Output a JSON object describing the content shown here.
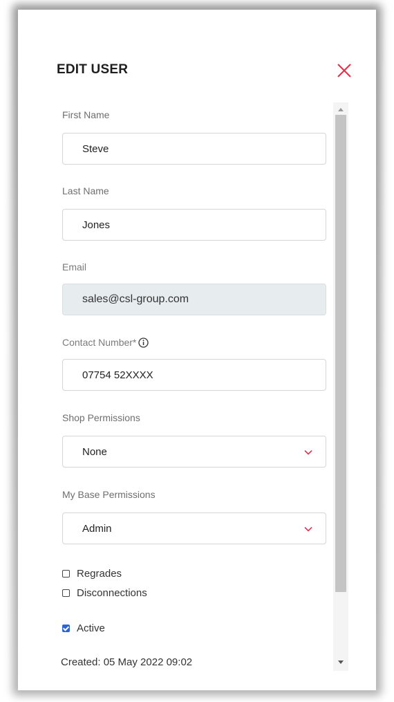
{
  "dialog": {
    "title": "EDIT USER"
  },
  "icons": {
    "close": "close-icon",
    "info": "info-icon",
    "chevron": "chevron-down-icon"
  },
  "colors": {
    "accent": "#e0344f",
    "checkbox_checked": "#2c63d8",
    "disabled_field": "#e7ecee"
  },
  "form": {
    "first_name": {
      "label": "First Name",
      "value": "Steve"
    },
    "last_name": {
      "label": "Last Name",
      "value": "Jones"
    },
    "email": {
      "label": "Email",
      "value": "sales@csl-group.com"
    },
    "contact": {
      "label": "Contact Number*",
      "value": "07754 52XXXX"
    },
    "shop_permissions": {
      "label": "Shop Permissions",
      "value": "None"
    },
    "mybase_permissions": {
      "label": "My Base Permissions",
      "value": "Admin"
    },
    "checkboxes": [
      {
        "label": "Regrades",
        "checked": false
      },
      {
        "label": "Disconnections",
        "checked": false
      },
      {
        "label": "Active",
        "checked": true
      }
    ],
    "created": "Created: 05 May 2022 09:02"
  }
}
